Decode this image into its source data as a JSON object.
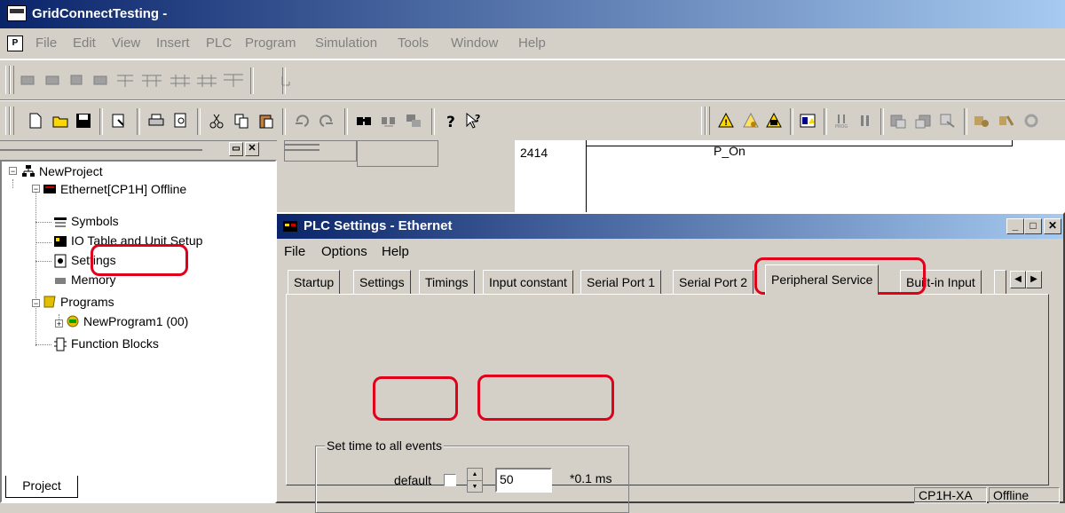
{
  "window": {
    "title": "GridConnectTesting -"
  },
  "menu": [
    "File",
    "Edit",
    "View",
    "Insert",
    "PLC",
    "Program",
    "Simulation",
    "Tools",
    "Window",
    "Help"
  ],
  "mdi_icon_label": "P",
  "behind": {
    "cell": "2414",
    "contact": "P_On"
  },
  "tree": {
    "root": "NewProject",
    "plc": "Ethernet[CP1H] Offline",
    "symbols": "Symbols",
    "io_table": "IO Table and Unit Setup",
    "settings": "Settings",
    "memory": "Memory",
    "programs": "Programs",
    "program1": "NewProgram1 (00)",
    "function_blocks": "Function Blocks",
    "tab": "Project"
  },
  "dialog": {
    "title": "PLC Settings - Ethernet",
    "menu": [
      "File",
      "Options",
      "Help"
    ],
    "tabs": [
      "Startup",
      "Settings",
      "Timings",
      "Input constant",
      "Serial Port 1",
      "Serial Port 2",
      "Peripheral Service",
      "Built-in Input"
    ],
    "group": {
      "legend": "Set time to all events",
      "default_label": "default",
      "value": "50",
      "unit": "*0.1 ms"
    },
    "status": {
      "model": "CP1H-XA",
      "mode": "Offline"
    }
  },
  "colors": {
    "highlight": "#e0001a",
    "title_start": "#0a246a",
    "title_end": "#a6caf0"
  }
}
